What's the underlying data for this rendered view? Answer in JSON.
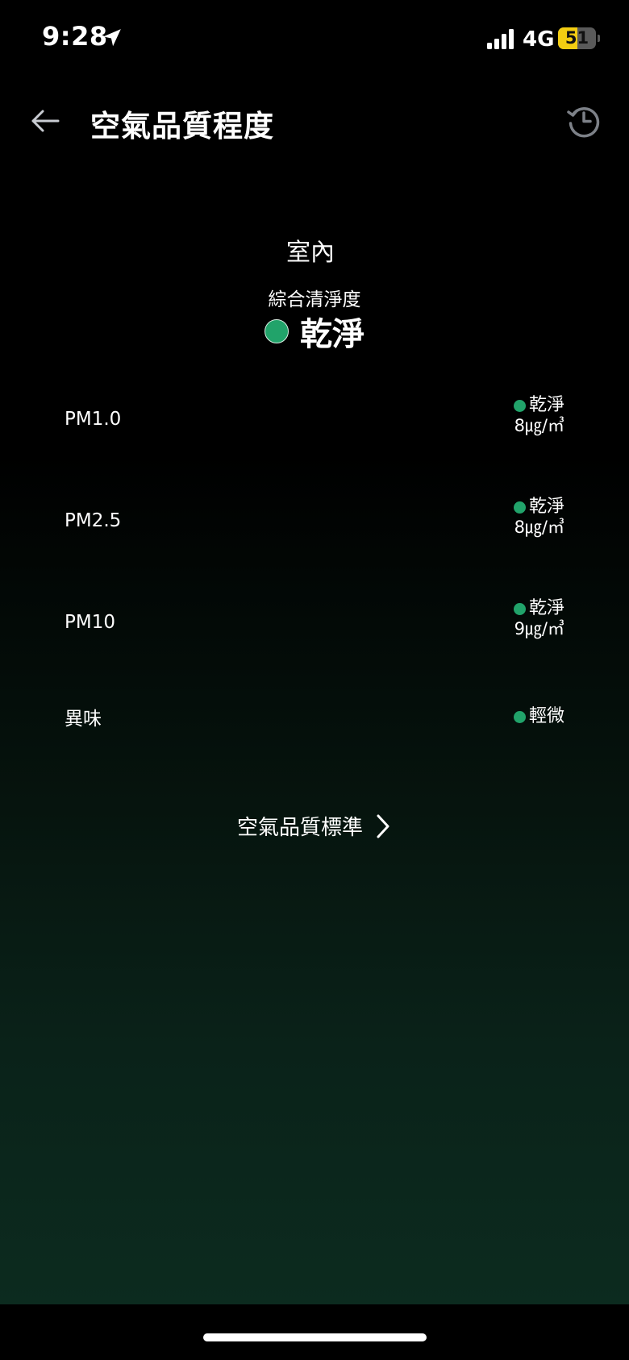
{
  "status_bar": {
    "time": "9:28",
    "network": "4G",
    "battery": "51",
    "battery_level_percent": 51,
    "battery_color": "#f3cd12"
  },
  "header": {
    "title": "空氣品質程度"
  },
  "summary": {
    "location": "室內",
    "overall_label": "綜合清淨度",
    "overall_value": "乾淨",
    "status_color": "#21a36a"
  },
  "metrics": [
    {
      "name": "PM1.0",
      "status": "乾淨",
      "value": "8㎍/㎥"
    },
    {
      "name": "PM2.5",
      "status": "乾淨",
      "value": "8㎍/㎥"
    },
    {
      "name": "PM10",
      "status": "乾淨",
      "value": "9㎍/㎥"
    },
    {
      "name": "異味",
      "status": "輕微",
      "value": ""
    }
  ],
  "standard_link": {
    "label": "空氣品質標準"
  },
  "icons": {
    "back": "arrow-left-icon",
    "history": "history-icon",
    "location": "location-arrow-icon",
    "chevron": "chevron-right-icon"
  }
}
